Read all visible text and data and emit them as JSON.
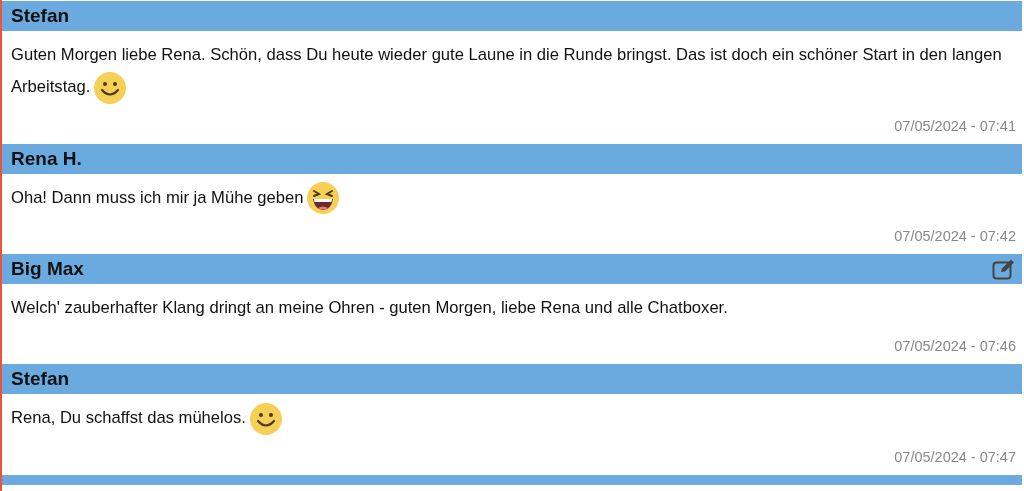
{
  "messages": [
    {
      "author": "Stefan",
      "editable": false,
      "text": "Guten Morgen liebe Rena. Schön, dass Du heute wieder gute Laune in die Runde bringst. Das ist doch ein schöner Start in den langen Arbeitstag.",
      "emoji": {
        "kind": "smile"
      },
      "time": "07/05/2024 - 07:41"
    },
    {
      "author": "Rena H.",
      "editable": false,
      "text": "Oha! Dann muss ich mir ja Mühe geben",
      "emoji": {
        "kind": "grin"
      },
      "time": "07/05/2024 - 07:42"
    },
    {
      "author": "Big Max",
      "editable": true,
      "text": "Welch' zauberhafter Klang dringt an meine Ohren - guten Morgen, liebe Rena und alle Chatboxer.",
      "time": "07/05/2024 - 07:46"
    },
    {
      "author": "Stefan",
      "editable": false,
      "text": "Rena, Du schaffst das mühelos.",
      "emoji": {
        "kind": "smile"
      },
      "time": "07/05/2024 - 07:47"
    }
  ]
}
